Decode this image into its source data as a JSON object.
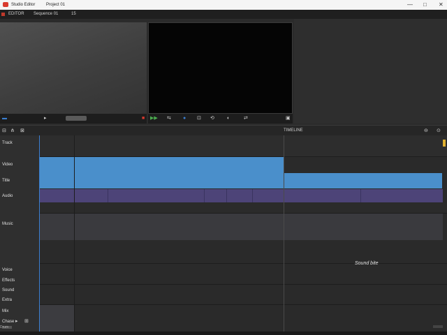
{
  "app": {
    "title": "Studio Editor",
    "subtitle": "Project 01",
    "menu_left": "EDITOR",
    "menu_right": "Sequence 01",
    "page_num": "15"
  },
  "window_controls": {
    "minimize": "—",
    "maximize": "□",
    "close": "✕"
  },
  "source_controls": {
    "timecode": "00:00:00:00"
  },
  "timeline": {
    "label": "TIMELINE",
    "tracks": [
      "Track",
      "Video",
      "Title",
      "Audio",
      "Music",
      "Voice",
      "Effects",
      "Sound",
      "Extra",
      "Mix",
      "Drum"
    ],
    "footer_label": "Chase"
  },
  "annotation": "Sound bite",
  "colors": {
    "accent_blue": "#4a8fcb",
    "accent_purple": "#4d4478",
    "playhead": "#3b7fd1",
    "record_red": "#d93a2e"
  }
}
